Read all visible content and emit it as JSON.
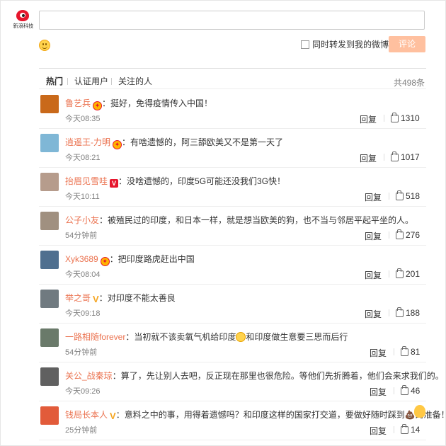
{
  "logo": {
    "text": "新浪科技"
  },
  "input": {
    "placeholder": "",
    "value": ""
  },
  "forward": {
    "label": "同时转发到我的微博"
  },
  "submit": {
    "label": "评论"
  },
  "tabs": [
    "热门",
    "认证用户",
    "关注的人"
  ],
  "total": "共498条",
  "comments": [
    {
      "name": "鲁艺兵",
      "badge": "crown",
      "text": "：挺好，免得疫情传入中国！",
      "time": "今天08:35",
      "reply": "回复",
      "likes": "1310",
      "avatar_color": "#c9691a"
    },
    {
      "name": "逍遥王-力明",
      "badge": "crown",
      "text": "：有啥遗憾的，阿三舔欧美又不是第一天了",
      "time": "今天08:21",
      "reply": "回复",
      "likes": "1017",
      "avatar_color": "#7fb7d6"
    },
    {
      "name": "抬眉见雪哇",
      "badge": "vred",
      "text": "：没啥遗憾的，印度5G可能还没我们3G快！",
      "time": "今天10:11",
      "reply": "回复",
      "likes": "518",
      "avatar_color": "#b69c8c"
    },
    {
      "name": "公子小友",
      "badge": "",
      "text": "：被殖民过的印度，和日本一样，就是想当欧美的狗，也不当与邻居平起平坐的人。",
      "time": "54分钟前",
      "reply": "回复",
      "likes": "276",
      "avatar_color": "#a09080"
    },
    {
      "name": "Xyk3689",
      "badge": "crown",
      "text": "：把印度路虎赶出中国",
      "time": "今天08:04",
      "reply": "回复",
      "likes": "201",
      "avatar_color": "#4f6f8f"
    },
    {
      "name": "举之哥",
      "badge": "vgold",
      "text": "：对印度不能太善良",
      "time": "今天09:18",
      "reply": "回复",
      "likes": "188",
      "avatar_color": "#707a80"
    },
    {
      "name": "一路相随forever",
      "badge": "",
      "text_before": "：当初就不该卖氧气机给印度",
      "emoji": true,
      "text_after": "和印度做生意要三思而后行",
      "time": "54分钟前",
      "reply": "回复",
      "likes": "81",
      "avatar_color": "#6a7a6a"
    },
    {
      "name": "关公_战秦琼",
      "badge": "",
      "text": "：算了，先让别人去吧，反正现在那里也很危险。等他们先折腾着，他们会来求我们的。",
      "time": "今天09:26",
      "reply": "回复",
      "likes": "46",
      "avatar_color": "#606060"
    },
    {
      "name": "钱局长本人",
      "badge": "vgold",
      "text": "：意料之中的事，用得着遗憾吗？和印度这样的国家打交道，要做好随时踩到💩的准备！",
      "time": "25分钟前",
      "reply": "回复",
      "likes": "14",
      "avatar_color": "#e25b3a"
    }
  ],
  "colors": {
    "name": "#eb7350",
    "submit_bg": "#ffc09f",
    "time": "#808080"
  }
}
